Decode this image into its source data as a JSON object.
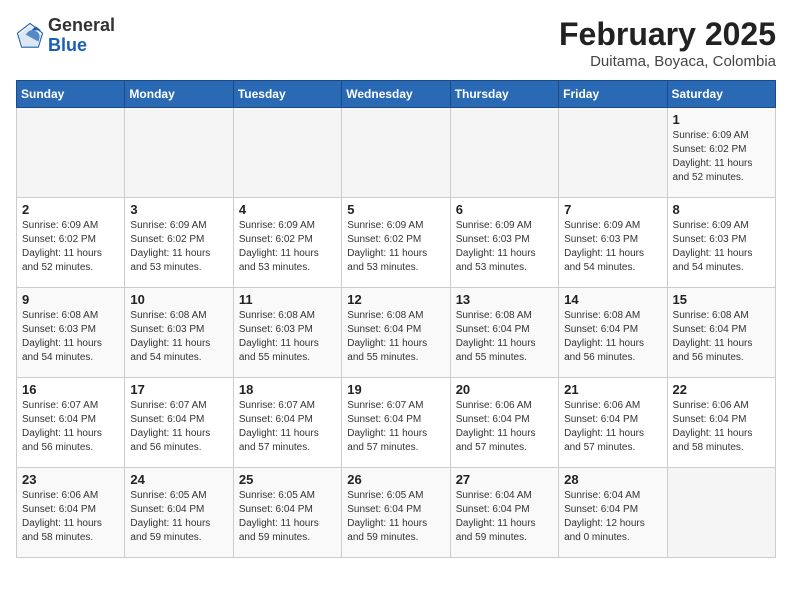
{
  "header": {
    "logo_general": "General",
    "logo_blue": "Blue",
    "title": "February 2025",
    "subtitle": "Duitama, Boyaca, Colombia"
  },
  "calendar": {
    "days_of_week": [
      "Sunday",
      "Monday",
      "Tuesday",
      "Wednesday",
      "Thursday",
      "Friday",
      "Saturday"
    ],
    "weeks": [
      [
        {
          "day": "",
          "info": ""
        },
        {
          "day": "",
          "info": ""
        },
        {
          "day": "",
          "info": ""
        },
        {
          "day": "",
          "info": ""
        },
        {
          "day": "",
          "info": ""
        },
        {
          "day": "",
          "info": ""
        },
        {
          "day": "1",
          "info": "Sunrise: 6:09 AM\nSunset: 6:02 PM\nDaylight: 11 hours and 52 minutes."
        }
      ],
      [
        {
          "day": "2",
          "info": "Sunrise: 6:09 AM\nSunset: 6:02 PM\nDaylight: 11 hours and 52 minutes."
        },
        {
          "day": "3",
          "info": "Sunrise: 6:09 AM\nSunset: 6:02 PM\nDaylight: 11 hours and 53 minutes."
        },
        {
          "day": "4",
          "info": "Sunrise: 6:09 AM\nSunset: 6:02 PM\nDaylight: 11 hours and 53 minutes."
        },
        {
          "day": "5",
          "info": "Sunrise: 6:09 AM\nSunset: 6:02 PM\nDaylight: 11 hours and 53 minutes."
        },
        {
          "day": "6",
          "info": "Sunrise: 6:09 AM\nSunset: 6:03 PM\nDaylight: 11 hours and 53 minutes."
        },
        {
          "day": "7",
          "info": "Sunrise: 6:09 AM\nSunset: 6:03 PM\nDaylight: 11 hours and 54 minutes."
        },
        {
          "day": "8",
          "info": "Sunrise: 6:09 AM\nSunset: 6:03 PM\nDaylight: 11 hours and 54 minutes."
        }
      ],
      [
        {
          "day": "9",
          "info": "Sunrise: 6:08 AM\nSunset: 6:03 PM\nDaylight: 11 hours and 54 minutes."
        },
        {
          "day": "10",
          "info": "Sunrise: 6:08 AM\nSunset: 6:03 PM\nDaylight: 11 hours and 54 minutes."
        },
        {
          "day": "11",
          "info": "Sunrise: 6:08 AM\nSunset: 6:03 PM\nDaylight: 11 hours and 55 minutes."
        },
        {
          "day": "12",
          "info": "Sunrise: 6:08 AM\nSunset: 6:04 PM\nDaylight: 11 hours and 55 minutes."
        },
        {
          "day": "13",
          "info": "Sunrise: 6:08 AM\nSunset: 6:04 PM\nDaylight: 11 hours and 55 minutes."
        },
        {
          "day": "14",
          "info": "Sunrise: 6:08 AM\nSunset: 6:04 PM\nDaylight: 11 hours and 56 minutes."
        },
        {
          "day": "15",
          "info": "Sunrise: 6:08 AM\nSunset: 6:04 PM\nDaylight: 11 hours and 56 minutes."
        }
      ],
      [
        {
          "day": "16",
          "info": "Sunrise: 6:07 AM\nSunset: 6:04 PM\nDaylight: 11 hours and 56 minutes."
        },
        {
          "day": "17",
          "info": "Sunrise: 6:07 AM\nSunset: 6:04 PM\nDaylight: 11 hours and 56 minutes."
        },
        {
          "day": "18",
          "info": "Sunrise: 6:07 AM\nSunset: 6:04 PM\nDaylight: 11 hours and 57 minutes."
        },
        {
          "day": "19",
          "info": "Sunrise: 6:07 AM\nSunset: 6:04 PM\nDaylight: 11 hours and 57 minutes."
        },
        {
          "day": "20",
          "info": "Sunrise: 6:06 AM\nSunset: 6:04 PM\nDaylight: 11 hours and 57 minutes."
        },
        {
          "day": "21",
          "info": "Sunrise: 6:06 AM\nSunset: 6:04 PM\nDaylight: 11 hours and 57 minutes."
        },
        {
          "day": "22",
          "info": "Sunrise: 6:06 AM\nSunset: 6:04 PM\nDaylight: 11 hours and 58 minutes."
        }
      ],
      [
        {
          "day": "23",
          "info": "Sunrise: 6:06 AM\nSunset: 6:04 PM\nDaylight: 11 hours and 58 minutes."
        },
        {
          "day": "24",
          "info": "Sunrise: 6:05 AM\nSunset: 6:04 PM\nDaylight: 11 hours and 59 minutes."
        },
        {
          "day": "25",
          "info": "Sunrise: 6:05 AM\nSunset: 6:04 PM\nDaylight: 11 hours and 59 minutes."
        },
        {
          "day": "26",
          "info": "Sunrise: 6:05 AM\nSunset: 6:04 PM\nDaylight: 11 hours and 59 minutes."
        },
        {
          "day": "27",
          "info": "Sunrise: 6:04 AM\nSunset: 6:04 PM\nDaylight: 11 hours and 59 minutes."
        },
        {
          "day": "28",
          "info": "Sunrise: 6:04 AM\nSunset: 6:04 PM\nDaylight: 12 hours and 0 minutes."
        },
        {
          "day": "",
          "info": ""
        }
      ]
    ]
  }
}
